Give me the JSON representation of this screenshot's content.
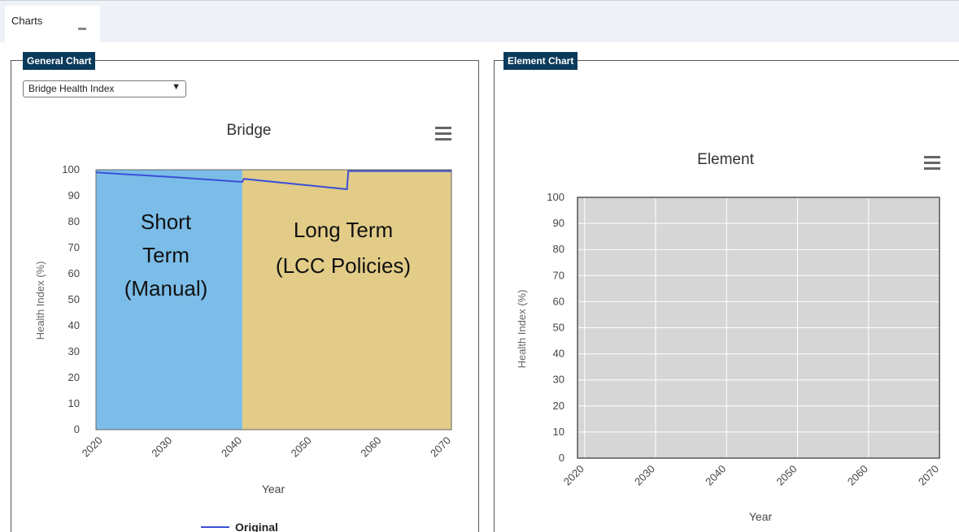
{
  "tabs": [
    {
      "label": "Charts"
    }
  ],
  "general_chart": {
    "legend": "General Chart",
    "dropdown_value": "Bridge Health Index",
    "title": "Bridge",
    "ylabel": "Health Index (%)",
    "xlabel": "Year",
    "annotations": {
      "short_term": [
        "Short",
        "Term",
        "(Manual)"
      ],
      "long_term": [
        "Long Term",
        "(LCC Policies)"
      ]
    },
    "legend_entry": "Original"
  },
  "element_chart": {
    "legend": "Element Chart",
    "title": "Element",
    "ylabel": "Health Index (%)",
    "xlabel": "Year"
  },
  "colors": {
    "header": "#0b3a5c",
    "short_term_fill": "#7bbde8",
    "long_term_fill": "#e2cc88",
    "series_line": "#3b4fd8",
    "element_plot_bg": "#d6d6d6"
  },
  "chart_data": [
    {
      "type": "line",
      "title": "Bridge",
      "xlabel": "Year",
      "ylabel": "Health Index (%)",
      "xlim": [
        2019,
        2070
      ],
      "ylim": [
        0,
        100
      ],
      "x_ticks": [
        2020,
        2030,
        2040,
        2050,
        2060,
        2070
      ],
      "y_ticks": [
        0,
        10,
        20,
        30,
        40,
        50,
        60,
        70,
        80,
        90,
        100
      ],
      "regions": [
        {
          "label": "Short Term (Manual)",
          "from": 2019,
          "to": 2040
        },
        {
          "label": "Long Term (LCC Policies)",
          "from": 2040,
          "to": 2070
        }
      ],
      "series": [
        {
          "name": "Original",
          "x": [
            2019,
            2020,
            2030,
            2040,
            2040.2,
            2055,
            2055.2,
            2070
          ],
          "y": [
            99,
            98.8,
            97.2,
            95.3,
            96.5,
            92.5,
            99.5,
            99.5
          ]
        }
      ]
    },
    {
      "type": "line",
      "title": "Element",
      "xlabel": "Year",
      "ylabel": "Health Index (%)",
      "xlim": [
        2019,
        2070
      ],
      "ylim": [
        0,
        100
      ],
      "x_ticks": [
        2020,
        2030,
        2040,
        2050,
        2060,
        2070
      ],
      "y_ticks": [
        0,
        10,
        20,
        30,
        40,
        50,
        60,
        70,
        80,
        90,
        100
      ],
      "series": []
    }
  ]
}
